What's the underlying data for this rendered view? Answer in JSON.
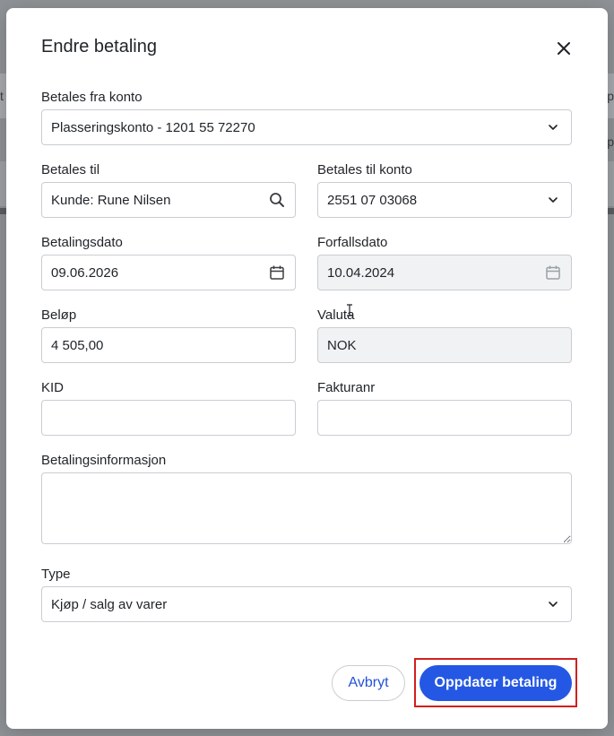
{
  "background": {
    "left_fragment": "t",
    "right_fragment_1": "p",
    "right_fragment_2": "p"
  },
  "dialog": {
    "title": "Endre betaling",
    "close_icon": "close-icon"
  },
  "fields": {
    "from_account": {
      "label": "Betales fra konto",
      "value": "Plasseringskonto - 1201 55 72270",
      "icon": "chevron-down-icon"
    },
    "pay_to": {
      "label": "Betales til",
      "value": "Kunde: Rune Nilsen",
      "icon": "search-icon"
    },
    "to_account": {
      "label": "Betales til konto",
      "value": "2551 07 03068",
      "icon": "chevron-down-icon"
    },
    "payment_date": {
      "label": "Betalingsdato",
      "value": "09.06.2026",
      "icon": "calendar-icon"
    },
    "due_date": {
      "label": "Forfallsdato",
      "value": "10.04.2024",
      "icon": "calendar-icon"
    },
    "amount": {
      "label": "Beløp",
      "value": "4 505,00"
    },
    "currency": {
      "label": "Valuta",
      "value": "NOK"
    },
    "kid": {
      "label": "KID",
      "value": ""
    },
    "invoice_no": {
      "label": "Fakturanr",
      "value": ""
    },
    "payment_info": {
      "label": "Betalingsinformasjon",
      "value": ""
    },
    "type": {
      "label": "Type",
      "value": "Kjøp / salg av varer",
      "icon": "chevron-down-icon"
    }
  },
  "actions": {
    "cancel_label": "Avbryt",
    "submit_label": "Oppdater betaling"
  },
  "colors": {
    "accent": "#2458e4",
    "highlight": "#d21f1f",
    "disabled_bg": "#f1f2f4"
  }
}
